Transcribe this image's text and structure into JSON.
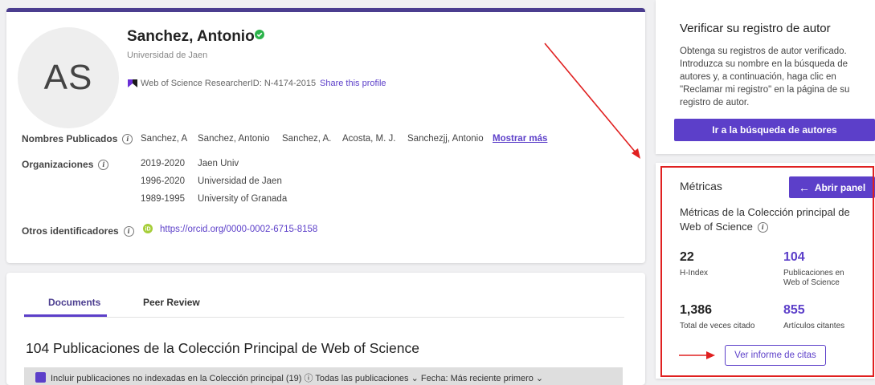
{
  "profile": {
    "initials": "AS",
    "name": "Sanchez, Antonio",
    "affiliation": "Universidad de Jaen",
    "researcher_id": "Web of Science ResearcherID: N-4174-2015",
    "share_label": "Share this profile",
    "published_names_label": "Nombres Publicados",
    "published_names": [
      "Sanchez, A",
      "Sanchez, Antonio",
      "Sanchez, A.",
      "Acosta, M. J.",
      "Sanchezjj, Antonio"
    ],
    "show_more": "Mostrar más",
    "organizations_label": "Organizaciones",
    "organizations": [
      {
        "years": "2019-2020",
        "name": "Jaen Univ"
      },
      {
        "years": "1996-2020",
        "name": "Universidad de Jaen"
      },
      {
        "years": "1989-1995",
        "name": "University of Granada"
      }
    ],
    "other_ids_label": "Otros identificadores",
    "orcid_url": "https://orcid.org/0000-0002-6715-8158"
  },
  "docs": {
    "tabs": [
      "Documents",
      "Peer Review"
    ],
    "heading": "104 Publicaciones de la Colección Principal de Web of Science",
    "filter_text": "Incluir publicaciones no indexadas en la Colección principal (19)   ⓘ              Todas las publicaciones ⌄    Fecha: Más reciente primero ⌄"
  },
  "verify": {
    "title": "Verificar su registro de autor",
    "body": "Obtenga su registros de autor verificado. Introduzca su nombre en la búsqueda de autores y, a continuación, haga clic en \"Reclamar mi registro\" en la página de su registro de autor.",
    "button": "Ir a la búsqueda de autores"
  },
  "metrics": {
    "title": "Métricas",
    "open_panel": "Abrir panel",
    "subtitle": "Métricas de la Colección principal de Web of Science",
    "items": [
      {
        "value": "22",
        "label": "H-Index"
      },
      {
        "value": "104",
        "label": "Publicaciones en Web of Science"
      },
      {
        "value": "1,386",
        "label": "Total de veces citado"
      },
      {
        "value": "855",
        "label": "Artículos citantes"
      }
    ],
    "report_button": "Ver informe de citas"
  },
  "colors": {
    "accent": "#5c3fc9",
    "annotation_red": "#e02020",
    "verified_green": "#2bb34a",
    "orcid_green": "#a6ce39"
  }
}
